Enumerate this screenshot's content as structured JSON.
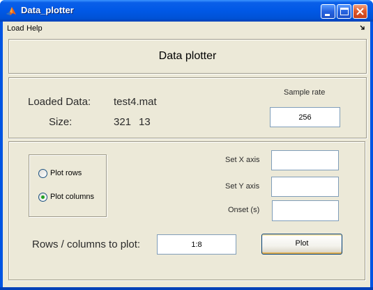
{
  "window": {
    "title": "Data_plotter",
    "icon": "matlab-logo-icon"
  },
  "menu": {
    "items": [
      "Load",
      "Help"
    ]
  },
  "header": {
    "title": "Data plotter"
  },
  "info": {
    "loaded_label": "Loaded Data:",
    "loaded_value": "test4.mat",
    "size_label": "Size:",
    "size_rows": "321",
    "size_cols": "13",
    "sample_rate_label": "Sample rate",
    "sample_rate_value": "256"
  },
  "controls": {
    "radio_options": [
      {
        "label": "Plot rows",
        "selected": false
      },
      {
        "label": "Plot columns",
        "selected": true
      }
    ],
    "x_axis_label": "Set X axis",
    "x_axis_value": "",
    "y_axis_label": "Set Y axis",
    "y_axis_value": "",
    "onset_label": "Onset (s)",
    "onset_value": "",
    "rows_cols_label": "Rows / columns to plot:",
    "rows_cols_value": "1:8",
    "plot_button": "Plot"
  },
  "colors": {
    "titlebar": "#0058e6",
    "client_bg": "#ece9d8",
    "radio_selected": "#21a121"
  }
}
